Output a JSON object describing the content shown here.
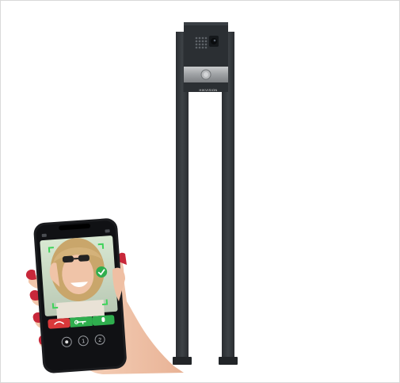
{
  "image": {
    "subject": "video-doorbell-on-stand-with-smartphone-app",
    "colors": {
      "background": "#ffffff",
      "frame_border": "#d9d9d9",
      "stand": "#34383c",
      "doorbell_panel": "#2b2f33",
      "metal_strip": "#a7a9ab",
      "phone_body": "#1b1c1f",
      "decline": "#d9383a",
      "accept": "#2fae4e",
      "skin": "#f0c4a8",
      "nail": "#c8283a"
    },
    "icons": [
      "speaker-grille-icon",
      "camera-lens-icon",
      "call-button-icon",
      "decline-call-icon",
      "key-icon",
      "microphone-icon",
      "record-icon",
      "one-icon",
      "two-icon",
      "check-icon"
    ]
  }
}
